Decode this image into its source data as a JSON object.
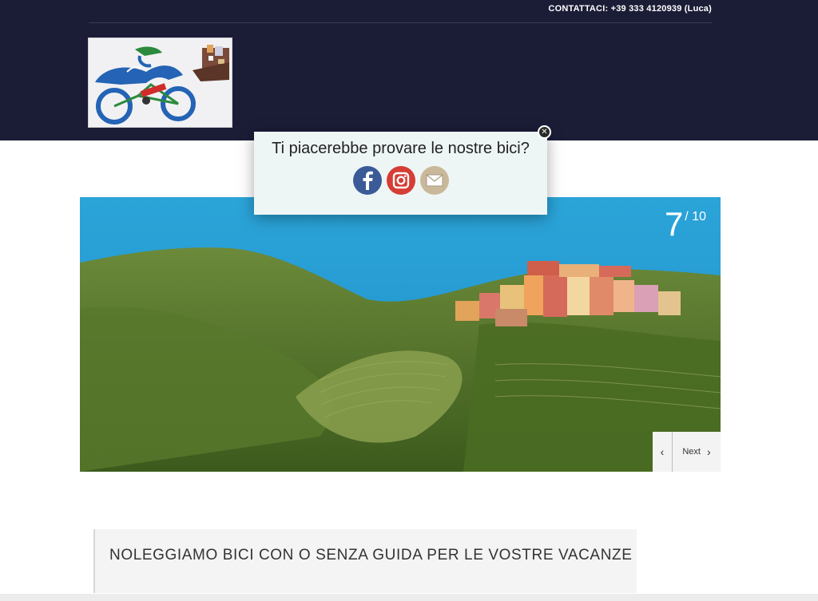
{
  "header": {
    "contact": "CONTATTACI: +39 333 4120939 (Luca)"
  },
  "logo": {
    "icon": "cyclist-logo-icon",
    "colors": {
      "blue": "#2463b5",
      "green": "#2b8a3e",
      "red": "#d12b2b"
    }
  },
  "popup": {
    "title": "Ti piacerebbe provare le nostre bici?",
    "icons": [
      "facebook-icon",
      "instagram-icon",
      "mail-icon"
    ],
    "colors": {
      "facebook": "#3b5b98",
      "instagram": "#d53d35",
      "mail": "#c9b89a"
    }
  },
  "slider": {
    "current": "7",
    "separator": "/",
    "total": "10",
    "next_label": "Next"
  },
  "tagline": "NOLEGGIAMO BICI CON O SENZA GUIDA PER LE VOSTRE VACANZE"
}
